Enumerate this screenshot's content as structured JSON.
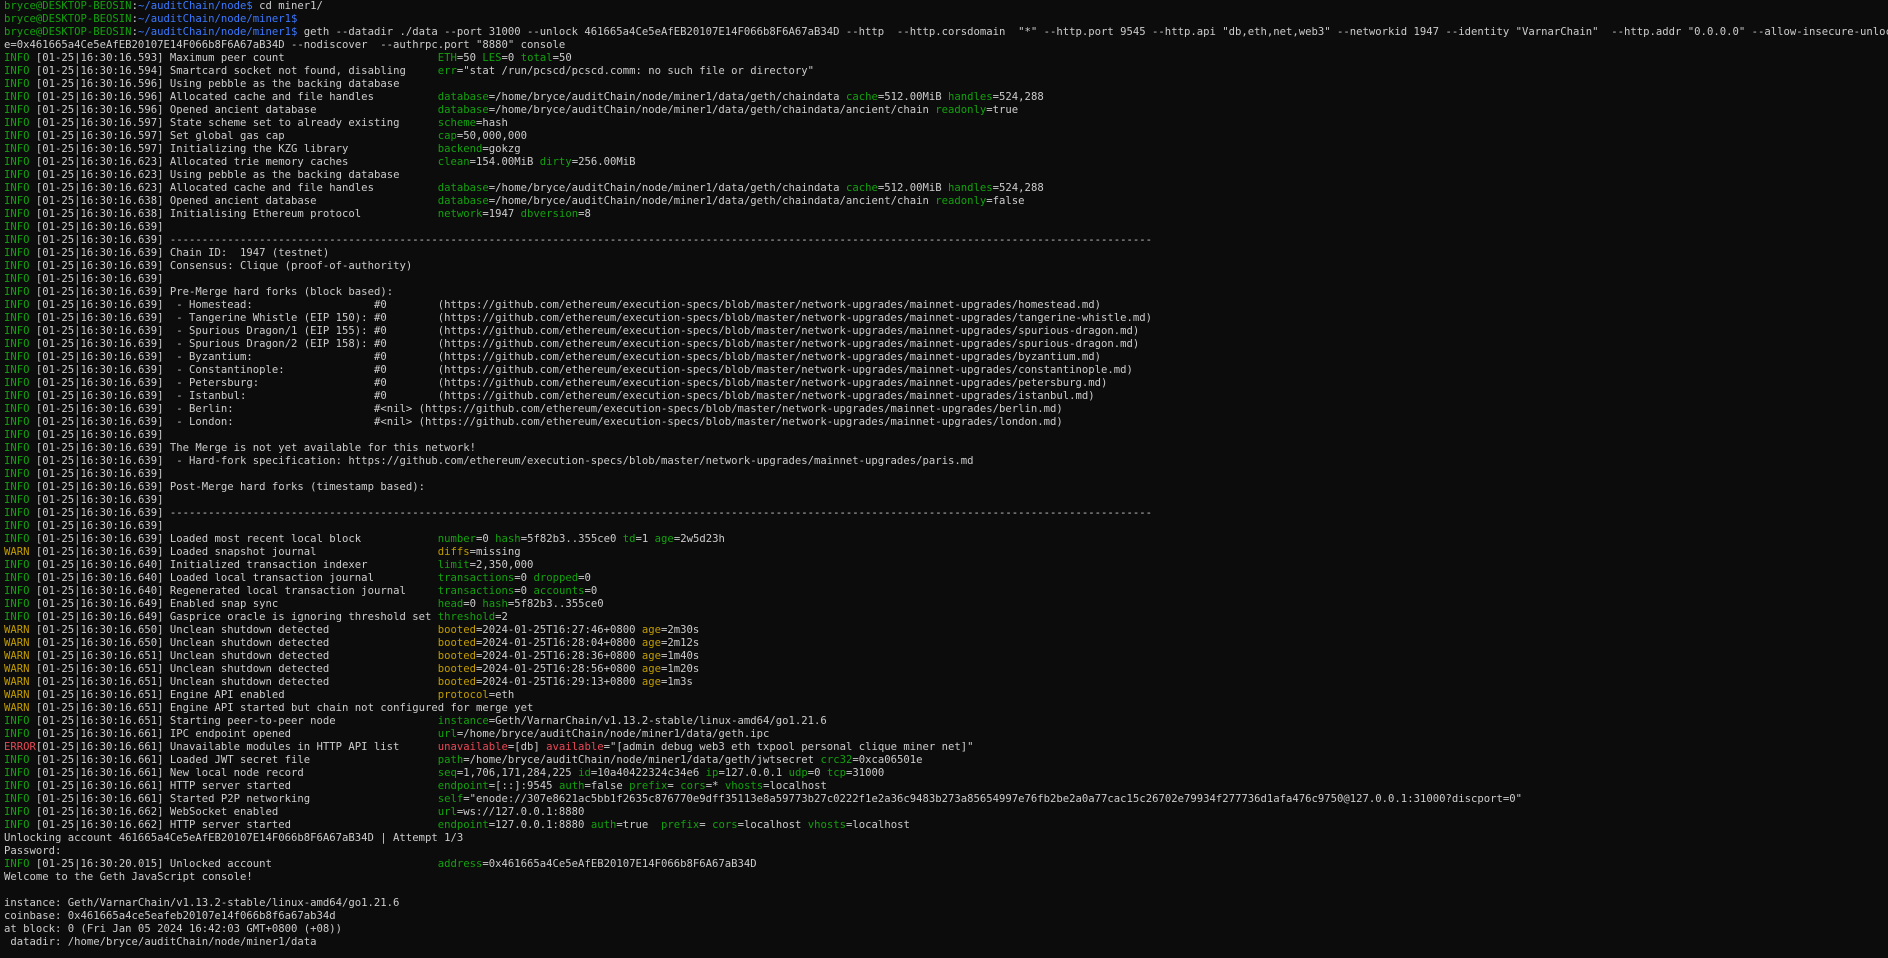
{
  "prompt": {
    "user_host": "bryce@DESKTOP-BEOSIN",
    "colon": ":"
  },
  "commands": [
    {
      "path": "~/auditChain/node",
      "cmd": " cd miner1/"
    },
    {
      "path": "~/auditChain/node/miner1",
      "cmd": ""
    },
    {
      "path": "~/auditChain/node/miner1",
      "cmd": " geth --datadir ./data --port 31000 --unlock 461665a4Ce5eAfEB20107E14F066b8F6A67aB34D --http  --http.corsdomain  \"*\" --http.port 9545 --http.api \"db,eth,net,web3\" --networkid 1947 --identity \"VarnarChain\"  --http.addr \"0.0.0.0\" --allow-insecure-unlock --miner.etherbas"
    }
  ],
  "wrapped_cmd": "e=0x461665a4Ce5eAfEB20107E14F066b8F6A67aB34D --nodiscover  --authrpc.port \"8880\" console",
  "log": [
    {
      "lvl": "INFO",
      "ts": "[01-25|16:30:16.593]",
      "msg": " Maximum peer count                       ",
      "kv": [
        [
          "ETH",
          "50",
          "g"
        ],
        [
          "LES",
          "0",
          "g"
        ],
        [
          "total",
          "50",
          "g"
        ]
      ]
    },
    {
      "lvl": "INFO",
      "ts": "[01-25|16:30:16.594]",
      "msg": " Smartcard socket not found, disabling    ",
      "kv": [
        [
          "err",
          "\"stat /run/pcscd/pcscd.comm: no such file or directory\"",
          "g"
        ]
      ]
    },
    {
      "lvl": "INFO",
      "ts": "[01-25|16:30:16.596]",
      "msg": " Using pebble as the backing database",
      "kv": []
    },
    {
      "lvl": "INFO",
      "ts": "[01-25|16:30:16.596]",
      "msg": " Allocated cache and file handles         ",
      "kv": [
        [
          "database",
          "/home/bryce/auditChain/node/miner1/data/geth/chaindata",
          "g"
        ],
        [
          "cache",
          "512.00MiB",
          "g"
        ],
        [
          "handles",
          "524,288",
          "g"
        ]
      ]
    },
    {
      "lvl": "INFO",
      "ts": "[01-25|16:30:16.596]",
      "msg": " Opened ancient database                  ",
      "kv": [
        [
          "database",
          "/home/bryce/auditChain/node/miner1/data/geth/chaindata/ancient/chain",
          "g"
        ],
        [
          "readonly",
          "true",
          "g"
        ]
      ]
    },
    {
      "lvl": "INFO",
      "ts": "[01-25|16:30:16.597]",
      "msg": " State scheme set to already existing     ",
      "kv": [
        [
          "scheme",
          "hash",
          "g"
        ]
      ]
    },
    {
      "lvl": "INFO",
      "ts": "[01-25|16:30:16.597]",
      "msg": " Set global gas cap                       ",
      "kv": [
        [
          "cap",
          "50,000,000",
          "g"
        ]
      ]
    },
    {
      "lvl": "INFO",
      "ts": "[01-25|16:30:16.597]",
      "msg": " Initializing the KZG library             ",
      "kv": [
        [
          "backend",
          "gokzg",
          "g"
        ]
      ]
    },
    {
      "lvl": "INFO",
      "ts": "[01-25|16:30:16.623]",
      "msg": " Allocated trie memory caches             ",
      "kv": [
        [
          "clean",
          "154.00MiB",
          "g"
        ],
        [
          "dirty",
          "256.00MiB",
          "g"
        ]
      ]
    },
    {
      "lvl": "INFO",
      "ts": "[01-25|16:30:16.623]",
      "msg": " Using pebble as the backing database",
      "kv": []
    },
    {
      "lvl": "INFO",
      "ts": "[01-25|16:30:16.623]",
      "msg": " Allocated cache and file handles         ",
      "kv": [
        [
          "database",
          "/home/bryce/auditChain/node/miner1/data/geth/chaindata",
          "g"
        ],
        [
          "cache",
          "512.00MiB",
          "g"
        ],
        [
          "handles",
          "524,288",
          "g"
        ]
      ]
    },
    {
      "lvl": "INFO",
      "ts": "[01-25|16:30:16.638]",
      "msg": " Opened ancient database                  ",
      "kv": [
        [
          "database",
          "/home/bryce/auditChain/node/miner1/data/geth/chaindata/ancient/chain",
          "g"
        ],
        [
          "readonly",
          "false",
          "g"
        ]
      ]
    },
    {
      "lvl": "INFO",
      "ts": "[01-25|16:30:16.638]",
      "msg": " Initialising Ethereum protocol           ",
      "kv": [
        [
          "network",
          "1947",
          "g"
        ],
        [
          "dbversion",
          "8",
          "g"
        ]
      ]
    },
    {
      "lvl": "INFO",
      "ts": "[01-25|16:30:16.639]",
      "msg": "",
      "kv": []
    },
    {
      "lvl": "INFO",
      "ts": "[01-25|16:30:16.639]",
      "msg": " ----------------------------------------------------------------------------------------------------------------------------------------------------------",
      "kv": []
    },
    {
      "lvl": "INFO",
      "ts": "[01-25|16:30:16.639]",
      "msg": " Chain ID:  1947 (testnet)",
      "kv": []
    },
    {
      "lvl": "INFO",
      "ts": "[01-25|16:30:16.639]",
      "msg": " Consensus: Clique (proof-of-authority)",
      "kv": []
    },
    {
      "lvl": "INFO",
      "ts": "[01-25|16:30:16.639]",
      "msg": "",
      "kv": []
    },
    {
      "lvl": "INFO",
      "ts": "[01-25|16:30:16.639]",
      "msg": " Pre-Merge hard forks (block based):",
      "kv": []
    },
    {
      "lvl": "INFO",
      "ts": "[01-25|16:30:16.639]",
      "msg": "  - Homestead:                   #0        (https://github.com/ethereum/execution-specs/blob/master/network-upgrades/mainnet-upgrades/homestead.md)",
      "kv": []
    },
    {
      "lvl": "INFO",
      "ts": "[01-25|16:30:16.639]",
      "msg": "  - Tangerine Whistle (EIP 150): #0        (https://github.com/ethereum/execution-specs/blob/master/network-upgrades/mainnet-upgrades/tangerine-whistle.md)",
      "kv": []
    },
    {
      "lvl": "INFO",
      "ts": "[01-25|16:30:16.639]",
      "msg": "  - Spurious Dragon/1 (EIP 155): #0        (https://github.com/ethereum/execution-specs/blob/master/network-upgrades/mainnet-upgrades/spurious-dragon.md)",
      "kv": []
    },
    {
      "lvl": "INFO",
      "ts": "[01-25|16:30:16.639]",
      "msg": "  - Spurious Dragon/2 (EIP 158): #0        (https://github.com/ethereum/execution-specs/blob/master/network-upgrades/mainnet-upgrades/spurious-dragon.md)",
      "kv": []
    },
    {
      "lvl": "INFO",
      "ts": "[01-25|16:30:16.639]",
      "msg": "  - Byzantium:                   #0        (https://github.com/ethereum/execution-specs/blob/master/network-upgrades/mainnet-upgrades/byzantium.md)",
      "kv": []
    },
    {
      "lvl": "INFO",
      "ts": "[01-25|16:30:16.639]",
      "msg": "  - Constantinople:              #0        (https://github.com/ethereum/execution-specs/blob/master/network-upgrades/mainnet-upgrades/constantinople.md)",
      "kv": []
    },
    {
      "lvl": "INFO",
      "ts": "[01-25|16:30:16.639]",
      "msg": "  - Petersburg:                  #0        (https://github.com/ethereum/execution-specs/blob/master/network-upgrades/mainnet-upgrades/petersburg.md)",
      "kv": []
    },
    {
      "lvl": "INFO",
      "ts": "[01-25|16:30:16.639]",
      "msg": "  - Istanbul:                    #0        (https://github.com/ethereum/execution-specs/blob/master/network-upgrades/mainnet-upgrades/istanbul.md)",
      "kv": []
    },
    {
      "lvl": "INFO",
      "ts": "[01-25|16:30:16.639]",
      "msg": "  - Berlin:                      #<nil> (https://github.com/ethereum/execution-specs/blob/master/network-upgrades/mainnet-upgrades/berlin.md)",
      "kv": []
    },
    {
      "lvl": "INFO",
      "ts": "[01-25|16:30:16.639]",
      "msg": "  - London:                      #<nil> (https://github.com/ethereum/execution-specs/blob/master/network-upgrades/mainnet-upgrades/london.md)",
      "kv": []
    },
    {
      "lvl": "INFO",
      "ts": "[01-25|16:30:16.639]",
      "msg": "",
      "kv": []
    },
    {
      "lvl": "INFO",
      "ts": "[01-25|16:30:16.639]",
      "msg": " The Merge is not yet available for this network!",
      "kv": []
    },
    {
      "lvl": "INFO",
      "ts": "[01-25|16:30:16.639]",
      "msg": "  - Hard-fork specification: https://github.com/ethereum/execution-specs/blob/master/network-upgrades/mainnet-upgrades/paris.md",
      "kv": []
    },
    {
      "lvl": "INFO",
      "ts": "[01-25|16:30:16.639]",
      "msg": "",
      "kv": []
    },
    {
      "lvl": "INFO",
      "ts": "[01-25|16:30:16.639]",
      "msg": " Post-Merge hard forks (timestamp based):",
      "kv": []
    },
    {
      "lvl": "INFO",
      "ts": "[01-25|16:30:16.639]",
      "msg": "",
      "kv": []
    },
    {
      "lvl": "INFO",
      "ts": "[01-25|16:30:16.639]",
      "msg": " ----------------------------------------------------------------------------------------------------------------------------------------------------------",
      "kv": []
    },
    {
      "lvl": "INFO",
      "ts": "[01-25|16:30:16.639]",
      "msg": "",
      "kv": []
    },
    {
      "lvl": "INFO",
      "ts": "[01-25|16:30:16.639]",
      "msg": " Loaded most recent local block           ",
      "kv": [
        [
          "number",
          "0",
          "g"
        ],
        [
          "hash",
          "5f82b3..355ce0",
          "g"
        ],
        [
          "td",
          "1",
          "g"
        ],
        [
          "age",
          "2w5d23h",
          "g"
        ]
      ]
    },
    {
      "lvl": "WARN",
      "ts": "[01-25|16:30:16.639]",
      "msg": " Loaded snapshot journal                  ",
      "kv": [
        [
          "diffs",
          "missing",
          "w"
        ]
      ]
    },
    {
      "lvl": "INFO",
      "ts": "[01-25|16:30:16.640]",
      "msg": " Initialized transaction indexer          ",
      "kv": [
        [
          "limit",
          "2,350,000",
          "g"
        ]
      ]
    },
    {
      "lvl": "INFO",
      "ts": "[01-25|16:30:16.640]",
      "msg": " Loaded local transaction journal         ",
      "kv": [
        [
          "transactions",
          "0",
          "g"
        ],
        [
          "dropped",
          "0",
          "g"
        ]
      ]
    },
    {
      "lvl": "INFO",
      "ts": "[01-25|16:30:16.640]",
      "msg": " Regenerated local transaction journal    ",
      "kv": [
        [
          "transactions",
          "0",
          "g"
        ],
        [
          "accounts",
          "0",
          "g"
        ]
      ]
    },
    {
      "lvl": "INFO",
      "ts": "[01-25|16:30:16.649]",
      "msg": " Enabled snap sync                        ",
      "kv": [
        [
          "head",
          "0",
          "g"
        ],
        [
          "hash",
          "5f82b3..355ce0",
          "g"
        ]
      ]
    },
    {
      "lvl": "INFO",
      "ts": "[01-25|16:30:16.649]",
      "msg": " Gasprice oracle is ignoring threshold set",
      "kv": [
        [
          "threshold",
          "2",
          "g"
        ]
      ]
    },
    {
      "lvl": "WARN",
      "ts": "[01-25|16:30:16.650]",
      "msg": " Unclean shutdown detected                ",
      "kv": [
        [
          "booted",
          "2024-01-25T16:27:46+0800",
          "w"
        ],
        [
          "age",
          "2m30s",
          "w"
        ]
      ]
    },
    {
      "lvl": "WARN",
      "ts": "[01-25|16:30:16.650]",
      "msg": " Unclean shutdown detected                ",
      "kv": [
        [
          "booted",
          "2024-01-25T16:28:04+0800",
          "w"
        ],
        [
          "age",
          "2m12s",
          "w"
        ]
      ]
    },
    {
      "lvl": "WARN",
      "ts": "[01-25|16:30:16.651]",
      "msg": " Unclean shutdown detected                ",
      "kv": [
        [
          "booted",
          "2024-01-25T16:28:36+0800",
          "w"
        ],
        [
          "age",
          "1m40s",
          "w"
        ]
      ]
    },
    {
      "lvl": "WARN",
      "ts": "[01-25|16:30:16.651]",
      "msg": " Unclean shutdown detected                ",
      "kv": [
        [
          "booted",
          "2024-01-25T16:28:56+0800",
          "w"
        ],
        [
          "age",
          "1m20s",
          "w"
        ]
      ]
    },
    {
      "lvl": "WARN",
      "ts": "[01-25|16:30:16.651]",
      "msg": " Unclean shutdown detected                ",
      "kv": [
        [
          "booted",
          "2024-01-25T16:29:13+0800",
          "w"
        ],
        [
          "age",
          "1m3s",
          "w"
        ]
      ]
    },
    {
      "lvl": "WARN",
      "ts": "[01-25|16:30:16.651]",
      "msg": " Engine API enabled                       ",
      "kv": [
        [
          "protocol",
          "eth",
          "w"
        ]
      ]
    },
    {
      "lvl": "WARN",
      "ts": "[01-25|16:30:16.651]",
      "msg": " Engine API started but chain not configured for merge yet",
      "kv": []
    },
    {
      "lvl": "INFO",
      "ts": "[01-25|16:30:16.651]",
      "msg": " Starting peer-to-peer node               ",
      "kv": [
        [
          "instance",
          "Geth/VarnarChain/v1.13.2-stable/linux-amd64/go1.21.6",
          "g"
        ]
      ]
    },
    {
      "lvl": "INFO",
      "ts": "[01-25|16:30:16.661]",
      "msg": " IPC endpoint opened                      ",
      "kv": [
        [
          "url",
          "/home/bryce/auditChain/node/miner1/data/geth.ipc",
          "g"
        ]
      ]
    },
    {
      "lvl": "ERROR",
      "ts": "[01-25|16:30:16.661]",
      "msg": " Unavailable modules in HTTP API list     ",
      "kv": [
        [
          "unavailable",
          "[db]",
          "e"
        ],
        [
          "available",
          "\"[admin debug web3 eth txpool personal clique miner net]\"",
          "e"
        ]
      ]
    },
    {
      "lvl": "INFO",
      "ts": "[01-25|16:30:16.661]",
      "msg": " Loaded JWT secret file                   ",
      "kv": [
        [
          "path",
          "/home/bryce/auditChain/node/miner1/data/geth/jwtsecret",
          "g"
        ],
        [
          "crc32",
          "0xca06501e",
          "g"
        ]
      ]
    },
    {
      "lvl": "INFO",
      "ts": "[01-25|16:30:16.661]",
      "msg": " New local node record                    ",
      "kv": [
        [
          "seq",
          "1,706,171,284,225",
          "g"
        ],
        [
          "id",
          "10a40422324c34e6",
          "g"
        ],
        [
          "ip",
          "127.0.0.1",
          "g"
        ],
        [
          "udp",
          "0",
          "g"
        ],
        [
          "tcp",
          "31000",
          "g"
        ]
      ]
    },
    {
      "lvl": "INFO",
      "ts": "[01-25|16:30:16.661]",
      "msg": " HTTP server started                      ",
      "kv": [
        [
          "endpoint",
          "[::]:9545",
          "g"
        ],
        [
          "auth",
          "false",
          "g"
        ],
        [
          "prefix",
          "",
          "g"
        ],
        [
          "cors",
          "*",
          "g"
        ],
        [
          "vhosts",
          "localhost",
          "g"
        ]
      ]
    },
    {
      "lvl": "INFO",
      "ts": "[01-25|16:30:16.661]",
      "msg": " Started P2P networking                   ",
      "kv": [
        [
          "self",
          "\"enode://307e8621ac5bb1f2635c876770e9dff35113e8a59773b27c0222f1e2a36c9483b273a85654997e76fb2be2a0a77cac15c26702e79934f277736d1afa476c9750@127.0.0.1:31000?discport=0\"",
          "g"
        ]
      ]
    },
    {
      "lvl": "INFO",
      "ts": "[01-25|16:30:16.662]",
      "msg": " WebSocket enabled                        ",
      "kv": [
        [
          "url",
          "ws://127.0.0.1:8880",
          "g"
        ]
      ]
    },
    {
      "lvl": "INFO",
      "ts": "[01-25|16:30:16.662]",
      "msg": " HTTP server started                      ",
      "kv": [
        [
          "endpoint",
          "127.0.0.1:8880",
          "g"
        ],
        [
          "auth",
          "true ",
          "g"
        ],
        [
          "prefix",
          "",
          "g"
        ],
        [
          "cors",
          "localhost",
          "g"
        ],
        [
          "vhosts",
          "localhost",
          "g"
        ]
      ]
    }
  ],
  "unlock_msg": "Unlocking account 461665a4Ce5eAfEB20107E14F066b8F6A67aB34D | Attempt 1/3",
  "password_prompt": "Password:",
  "unlocked": {
    "lvl": "INFO",
    "ts": "[01-25|16:30:20.015]",
    "msg": " Unlocked account                         ",
    "kv": [
      [
        "address",
        "0x461665a4Ce5eAfEB20107E14F066b8F6A67aB34D",
        "g"
      ]
    ]
  },
  "welcome": "Welcome to the Geth JavaScript console!",
  "console_info": [
    "",
    "instance: Geth/VarnarChain/v1.13.2-stable/linux-amd64/go1.21.6",
    "coinbase: 0x461665a4ce5eafeb20107e14f066b8f6a67ab34d",
    "at block: 0 (Fri Jan 05 2024 16:42:03 GMT+0800 (+08))",
    " datadir: /home/bryce/auditChain/node/miner1/data"
  ],
  "colors": {
    "background": "#0c0c0c",
    "foreground": "#cccccc",
    "green": "#13a10e",
    "blue": "#3b78ff",
    "yellow": "#c19c00",
    "red": "#e74856"
  }
}
